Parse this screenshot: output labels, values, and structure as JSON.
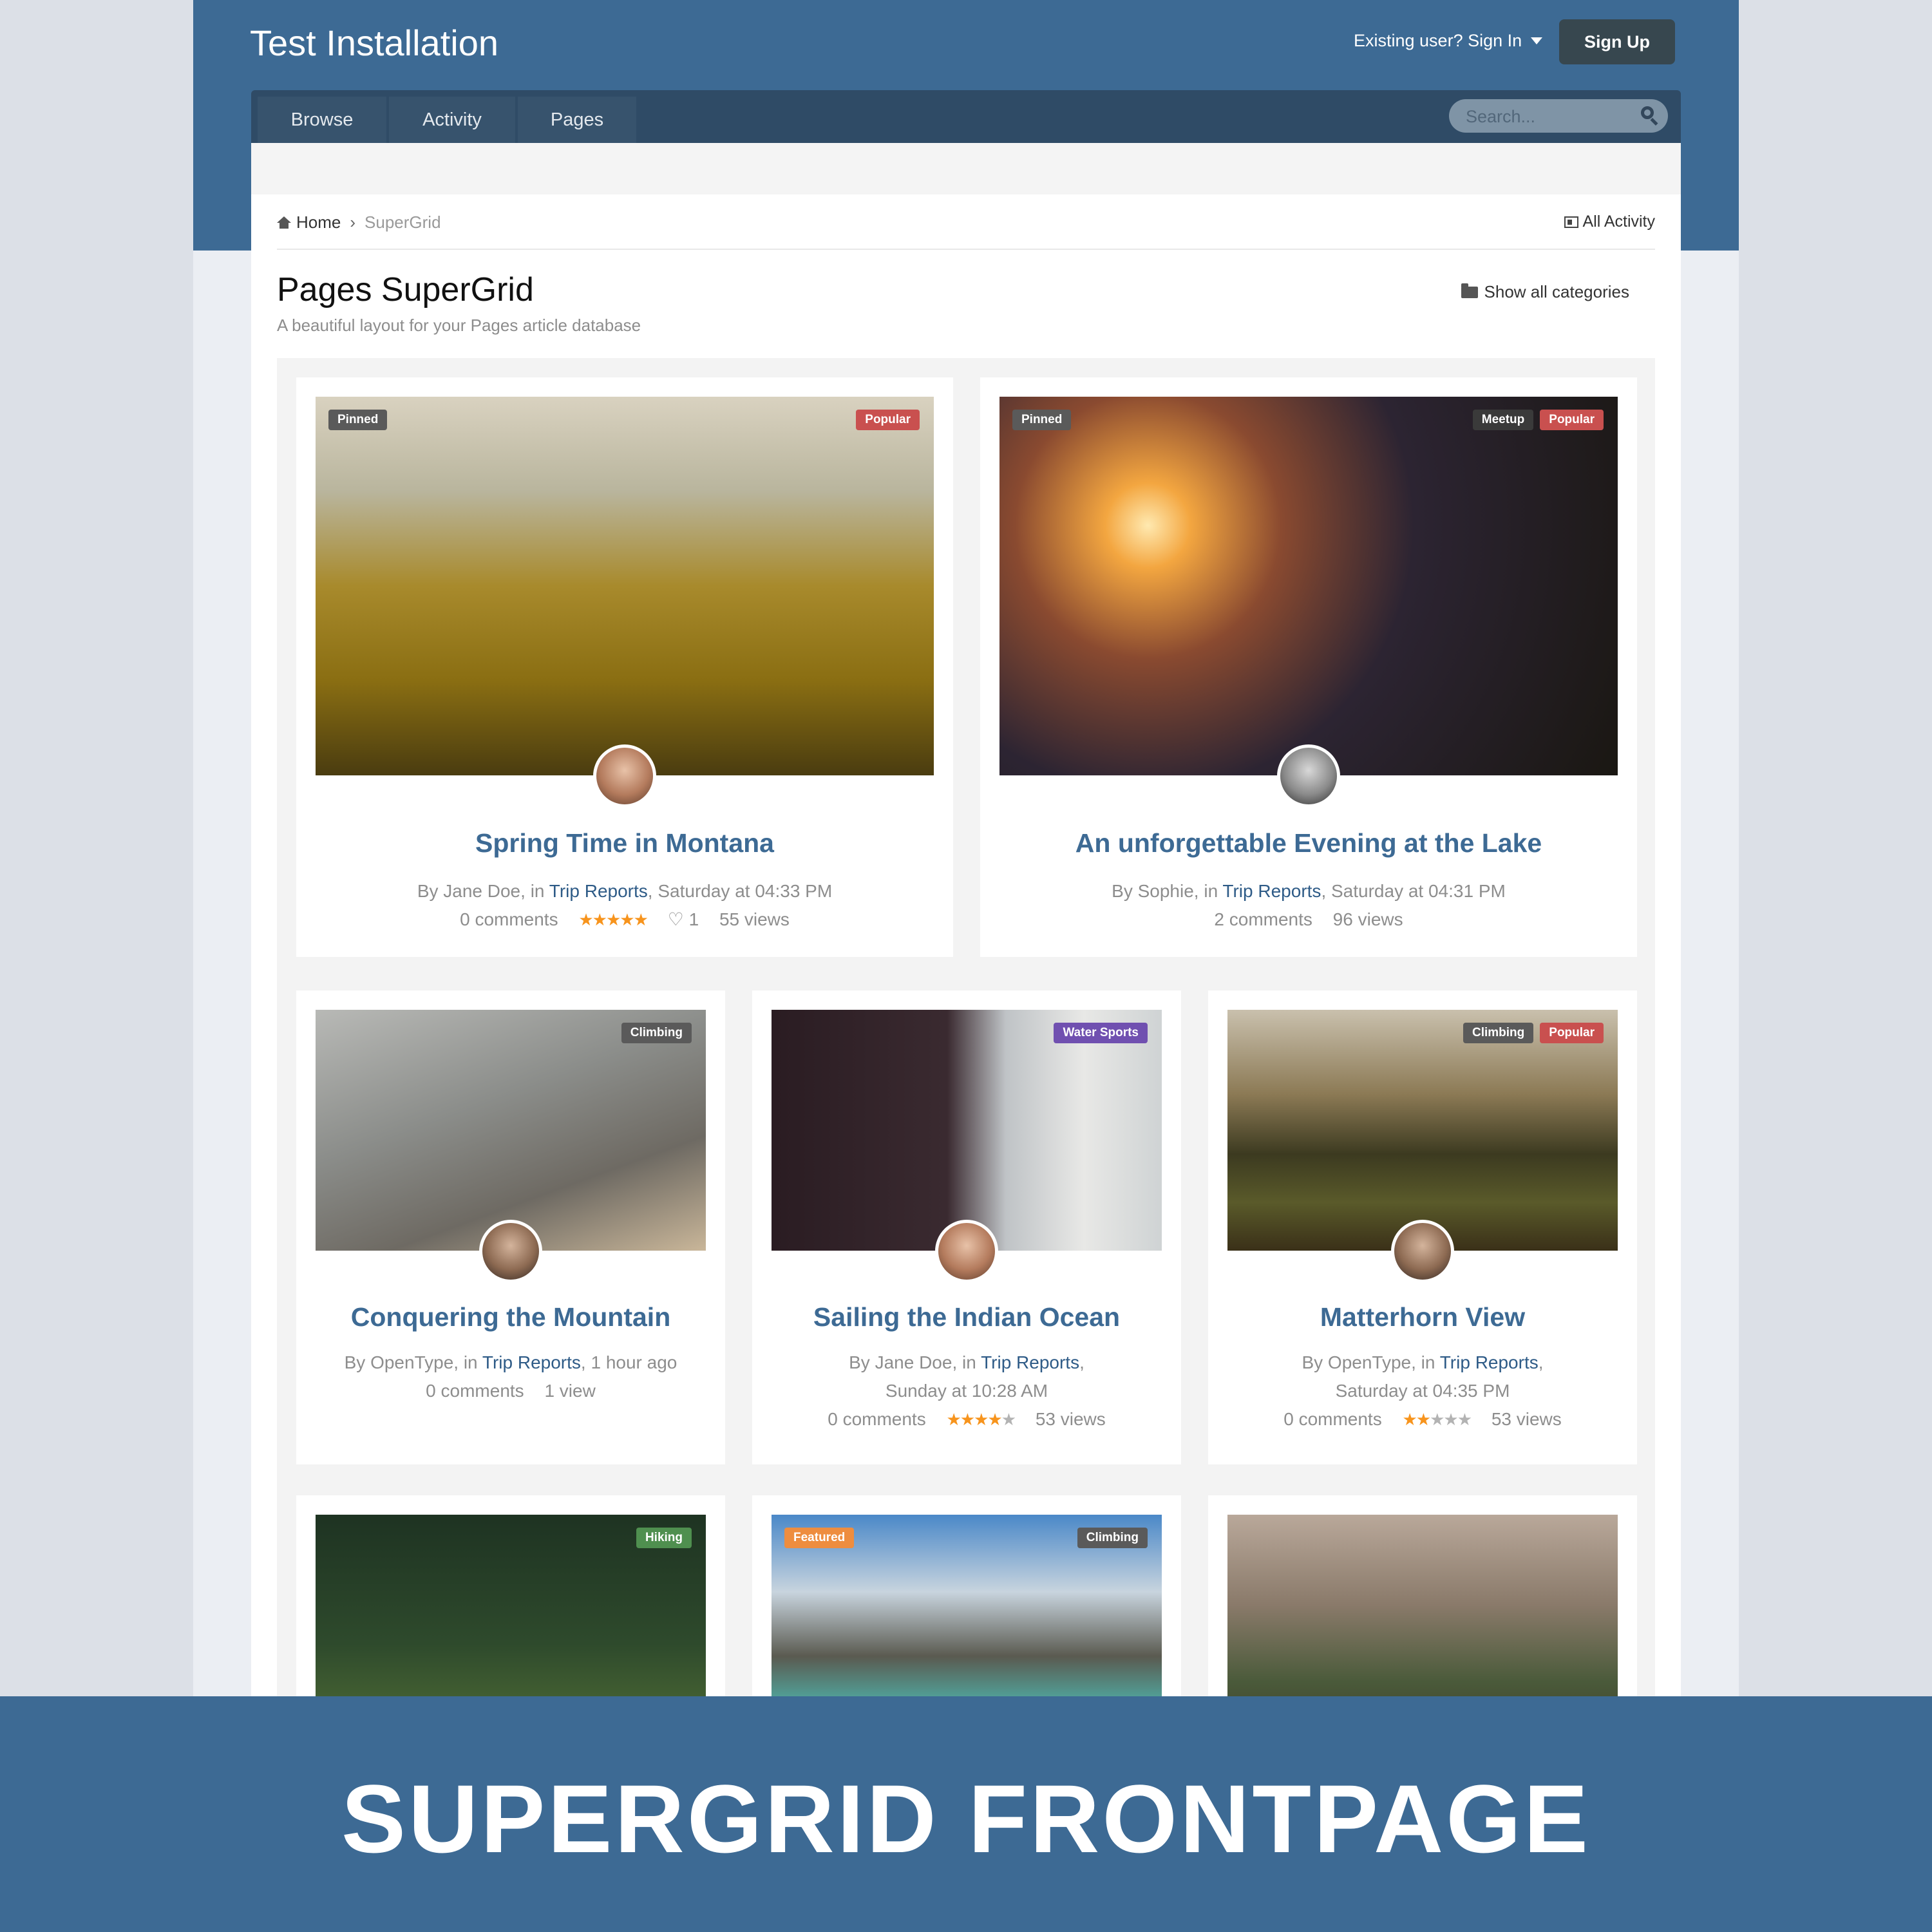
{
  "header": {
    "site_title": "Test Installation",
    "signin_label": "Existing user? Sign In",
    "signup_label": "Sign Up",
    "nav_tabs": [
      {
        "label": "Browse"
      },
      {
        "label": "Activity"
      },
      {
        "label": "Pages"
      }
    ],
    "search": {
      "placeholder": "Search..."
    }
  },
  "breadcrumb": {
    "home": "Home",
    "current": "SuperGrid"
  },
  "all_activity_label": "All Activity",
  "page": {
    "title": "Pages SuperGrid",
    "subtitle": "A beautiful layout for your Pages article database",
    "show_categories_label": "Show all categories"
  },
  "colors": {
    "brand": "#3d6a94",
    "badge_pinned": "#5a5a5a",
    "badge_popular": "#c9504f",
    "badge_meetup": "#3a3a3a",
    "badge_water_sports": "#7050b0",
    "badge_hiking": "#4f8f4f",
    "badge_featured": "#ee8d3f",
    "badge_climbing": "#5a5a5a",
    "star_on": "#f7941d",
    "star_off": "#b3b3b3"
  },
  "cards": [
    {
      "title": "Spring Time in Montana",
      "badges_left": [
        "Pinned"
      ],
      "badges_right": [
        "Popular"
      ],
      "author_prefix": "By Jane Doe, in ",
      "category": "Trip Reports",
      "time": ", Saturday at 04:33  PM",
      "comments": "0 comments",
      "rating": 5,
      "likes": "1",
      "views": "55 views"
    },
    {
      "title": "An unforgettable Evening at the Lake",
      "badges_left": [
        "Pinned"
      ],
      "badges_right": [
        "Meetup",
        "Popular"
      ],
      "author_prefix": "By Sophie, in ",
      "category": "Trip Reports",
      "time": ", Saturday at 04:31  PM",
      "comments": "2 comments",
      "views": "96 views"
    },
    {
      "title": "Conquering the Mountain",
      "badges_right": [
        "Climbing"
      ],
      "author_prefix": "By OpenType, in ",
      "category": "Trip Reports",
      "time": ", 1 hour ago",
      "comments": "0 comments",
      "views": "1 view"
    },
    {
      "title": "Sailing the Indian Ocean",
      "badges_right": [
        "Water Sports"
      ],
      "author_prefix": "By Jane Doe, in ",
      "category": "Trip Reports",
      "time_line2": "Sunday at 10:28  AM",
      "comments": "0 comments",
      "rating": 4,
      "views": "53 views"
    },
    {
      "title": "Matterhorn View",
      "badges_right": [
        "Climbing",
        "Popular"
      ],
      "author_prefix": "By OpenType, in ",
      "category": "Trip Reports",
      "time_line2": "Saturday at 04:35  PM",
      "comments": "0 comments",
      "rating": 2,
      "views": "53 views"
    },
    {
      "badges_right": [
        "Hiking"
      ]
    },
    {
      "badges_left": [
        "Featured"
      ],
      "badges_right": [
        "Climbing"
      ]
    },
    {}
  ],
  "footer": {
    "banner_text": "SUPERGRID FRONTPAGE"
  }
}
